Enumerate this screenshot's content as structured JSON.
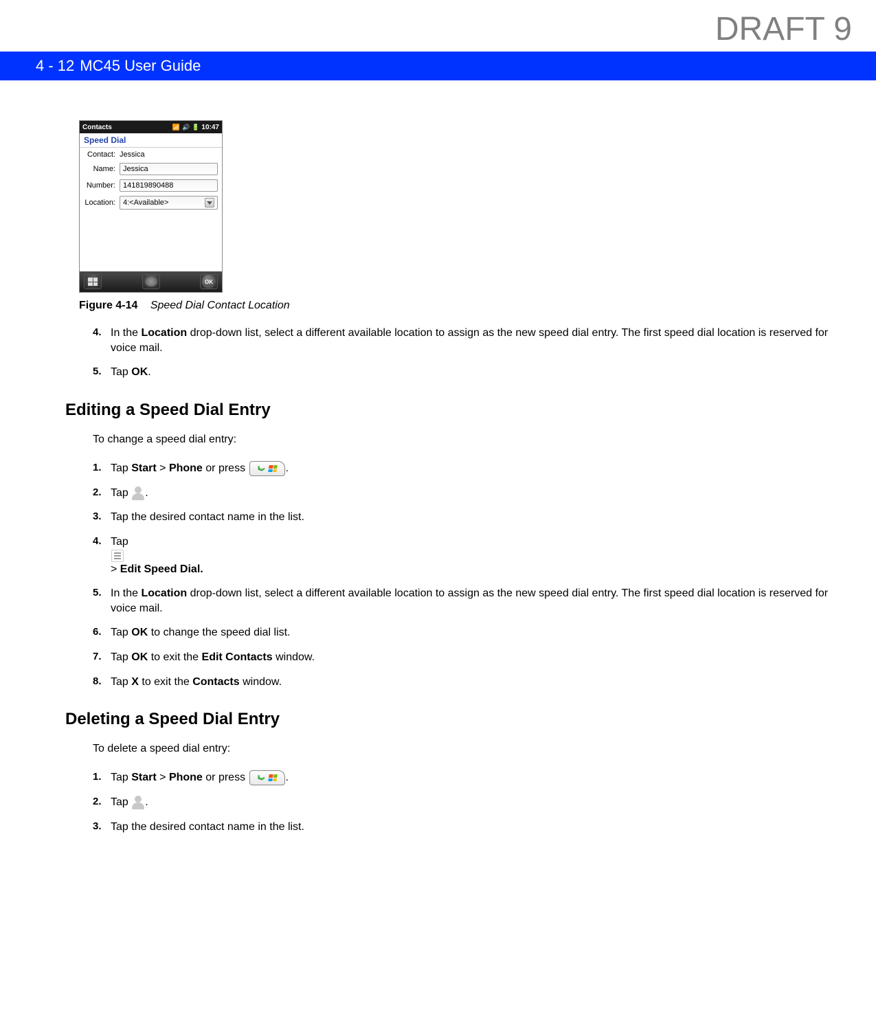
{
  "watermark": "DRAFT 9",
  "header": {
    "page_num": "4 - 12",
    "doc_title": "MC45 User Guide"
  },
  "screenshot": {
    "titlebar": "Contacts",
    "time": "10:47",
    "tab": "Speed Dial",
    "fields": {
      "contact_label": "Contact:",
      "contact_value": "Jessica",
      "name_label": "Name:",
      "name_value": "Jessica",
      "number_label": "Number:",
      "number_value": "141819890488",
      "location_label": "Location:",
      "location_value": "4:<Available>"
    },
    "ok_button": "OK"
  },
  "figure": {
    "label": "Figure 4-14",
    "title": "Speed Dial Contact Location"
  },
  "steps_top": [
    {
      "num": "4.",
      "pre": "In the ",
      "bold1": "Location",
      "post": " drop-down list, select a different available location to assign as the new speed dial entry. The first speed dial location is reserved for voice mail."
    },
    {
      "num": "5.",
      "pre": "Tap ",
      "bold1": "OK",
      "post": "."
    }
  ],
  "section1": {
    "heading": "Editing a Speed Dial Entry",
    "intro": "To change a speed dial entry:",
    "steps": [
      {
        "num": "1.",
        "text_pre": "Tap ",
        "bold1": "Start",
        "mid1": " > ",
        "bold2": "Phone",
        "mid2": " or press ",
        "icon": "phone",
        "text_post": "."
      },
      {
        "num": "2.",
        "text_pre": "Tap ",
        "icon": "contact",
        "text_post": "."
      },
      {
        "num": "3.",
        "text_pre": "Tap the desired contact name in the list."
      },
      {
        "num": "4.",
        "text_pre": "Tap  ",
        "icon": "menu",
        "mid1": " > ",
        "bold1": "Edit Speed Dial."
      },
      {
        "num": "5.",
        "text_pre": "In the ",
        "bold1": "Location",
        "text_post": " drop-down list, select a different available location to assign as the new speed dial entry. The first speed dial location is reserved for voice mail."
      },
      {
        "num": "6.",
        "text_pre": "Tap ",
        "bold1": "OK",
        "text_post": " to change the speed dial list."
      },
      {
        "num": "7.",
        "text_pre": "Tap ",
        "bold1": "OK",
        "mid1": " to exit the ",
        "bold2": "Edit Contacts",
        "text_post": " window."
      },
      {
        "num": "8.",
        "text_pre": "Tap ",
        "bold1": "X",
        "mid1": " to exit the ",
        "bold2": "Contacts",
        "text_post": " window."
      }
    ]
  },
  "section2": {
    "heading": "Deleting a Speed Dial Entry",
    "intro": "To delete a speed dial entry:",
    "steps": [
      {
        "num": "1.",
        "text_pre": "Tap ",
        "bold1": "Start",
        "mid1": " > ",
        "bold2": "Phone",
        "mid2": " or press ",
        "icon": "phone",
        "text_post": "."
      },
      {
        "num": "2.",
        "text_pre": "Tap ",
        "icon": "contact",
        "text_post": "."
      },
      {
        "num": "3.",
        "text_pre": "Tap the desired contact name in the list."
      }
    ]
  }
}
